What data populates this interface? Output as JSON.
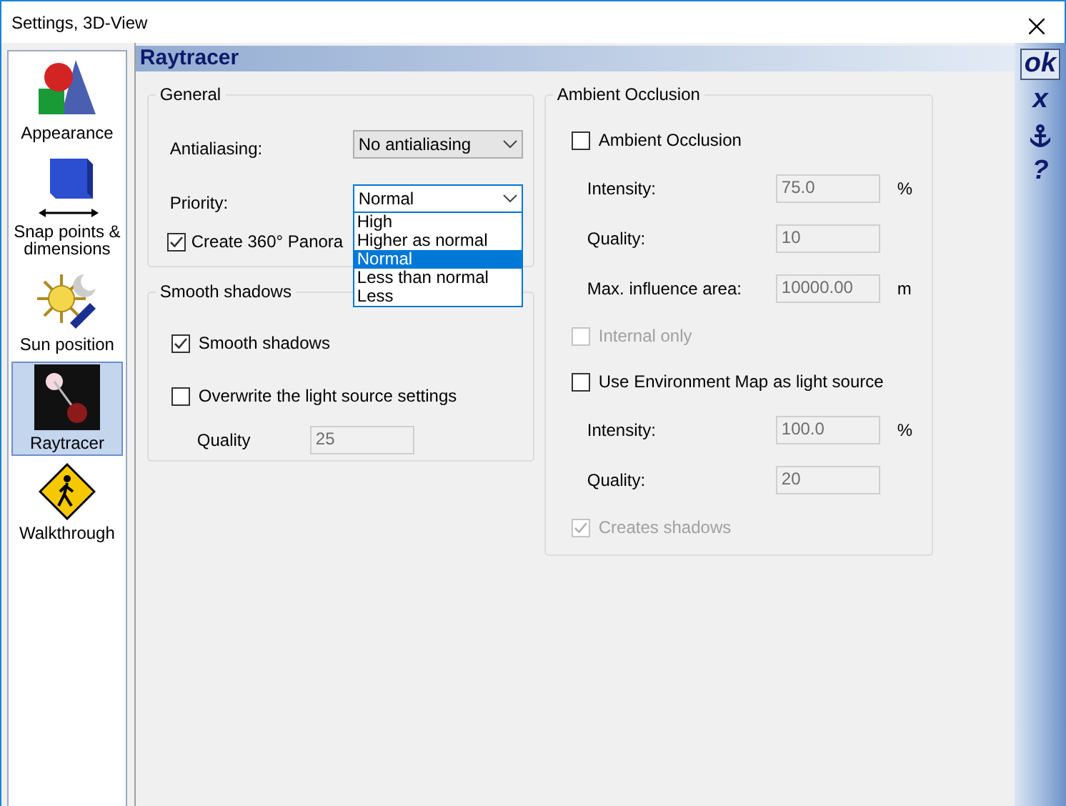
{
  "window": {
    "title": "Settings, 3D-View"
  },
  "sidebar": {
    "items": [
      {
        "label": "Appearance",
        "kind": "shapes",
        "selected": false
      },
      {
        "label": "Snap points & dimensions",
        "kind": "cube",
        "selected": false
      },
      {
        "label": "Sun position",
        "kind": "sun",
        "selected": false
      },
      {
        "label": "Raytracer",
        "kind": "light",
        "selected": true
      },
      {
        "label": "Walkthrough",
        "kind": "sign",
        "selected": false
      }
    ]
  },
  "header": {
    "title": "Raytracer"
  },
  "toolbar": {
    "buttons": [
      {
        "kind": "text",
        "label": "ok",
        "focused": true
      },
      {
        "kind": "text",
        "label": "x",
        "focused": false
      },
      {
        "kind": "icon",
        "focused": false
      },
      {
        "kind": "text",
        "label": "?",
        "focused": false
      }
    ]
  },
  "general": {
    "title": "General",
    "antialiasing": {
      "label": "Antialiasing:",
      "value": "No antialiasing",
      "expanded": false
    },
    "priority": {
      "label": "Priority:",
      "value": "Normal",
      "expanded": true,
      "options": [
        {
          "label": "High",
          "selected": false
        },
        {
          "label": "Higher as normal",
          "selected": false
        },
        {
          "label": "Normal",
          "selected": true
        },
        {
          "label": "Less than normal",
          "selected": false
        },
        {
          "label": "Less",
          "selected": false
        }
      ]
    },
    "panorama": {
      "label": "Create 360° Panora",
      "checked": true,
      "disabled": false
    }
  },
  "smooth_shadows": {
    "title": "Smooth shadows",
    "rows": [
      {
        "kind": "checkbox",
        "label": "Smooth shadows",
        "checked": true,
        "disabled": false
      },
      {
        "kind": "checkbox",
        "label": "Overwrite the light source settings",
        "checked": false,
        "disabled": false
      },
      {
        "kind": "field",
        "label": "Quality",
        "value": "25",
        "disabled": true
      }
    ]
  },
  "ambient_occlusion": {
    "title": "Ambient Occlusion",
    "rows": [
      {
        "kind": "checkbox",
        "label": "Ambient Occlusion",
        "checked": false,
        "disabled": false
      },
      {
        "kind": "field",
        "label": "Intensity:",
        "value": "75.0",
        "unit": "%",
        "disabled": true
      },
      {
        "kind": "field",
        "label": "Quality:",
        "value": "10",
        "disabled": true
      },
      {
        "kind": "field",
        "label": "Max. influence area:",
        "value": "10000.00",
        "unit": "m",
        "disabled": true
      },
      {
        "kind": "checkbox",
        "label": "Internal only",
        "checked": false,
        "disabled": true
      },
      {
        "kind": "checkbox",
        "label": "Use Environment Map as light source",
        "checked": false,
        "disabled": false
      },
      {
        "kind": "field",
        "label": "Intensity:",
        "value": "100.0",
        "unit": "%",
        "disabled": true
      },
      {
        "kind": "field",
        "label": "Quality:",
        "value": "20",
        "disabled": true
      },
      {
        "kind": "checkbox",
        "label": "Creates shadows",
        "checked": true,
        "disabled": true
      }
    ]
  }
}
